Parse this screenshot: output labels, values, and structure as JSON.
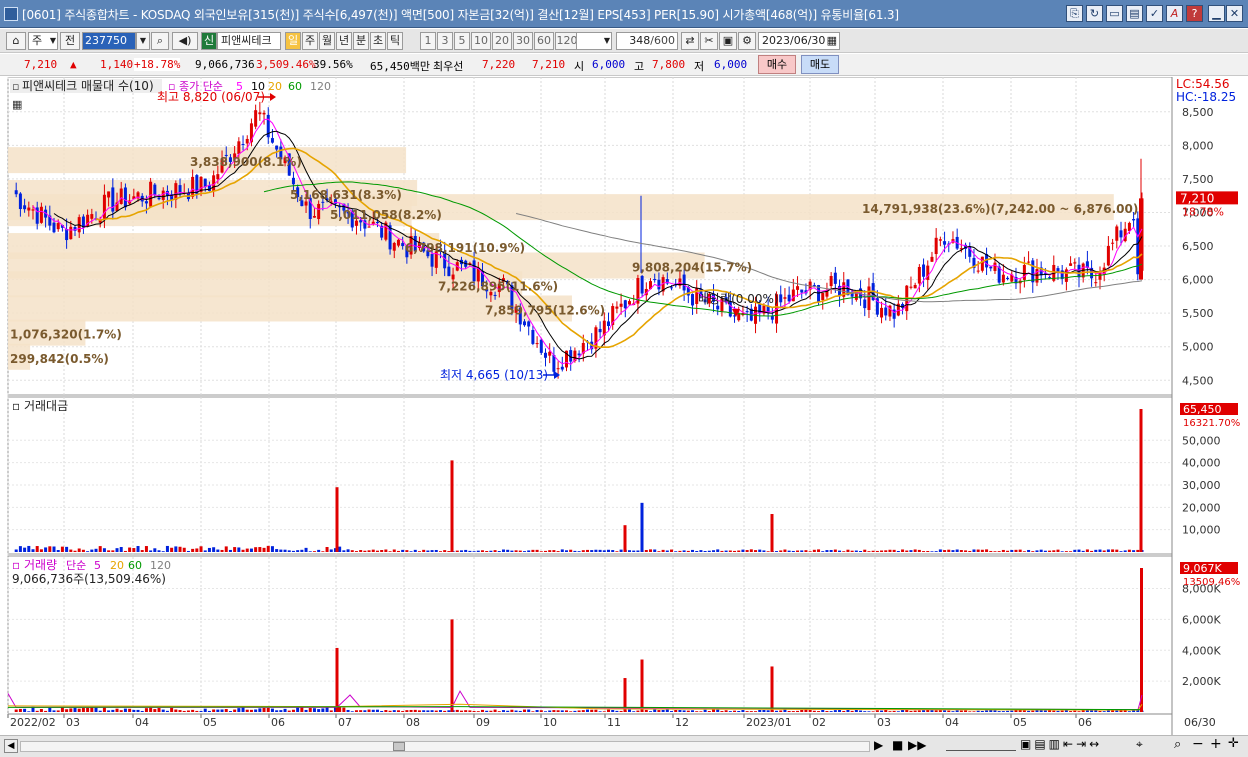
{
  "window": {
    "title": "[0601] 주식종합차트 - KOSDAQ 외국인보유[315(천)] 주식수[6,497(천)] 액면[500] 자본금[32(억)] 결산[12월] EPS[453] PER[15.90] 시가총액[468(억)] 유통비율[61.3]",
    "icons": [
      "link-icon",
      "refresh-icon",
      "window-icon",
      "monitor-icon",
      "settings-icon",
      "font-icon",
      "help-icon",
      "minimize-icon",
      "restore-icon",
      "close-icon"
    ]
  },
  "toolbar": {
    "period_select": "주",
    "prev_label": "전",
    "code": "237750",
    "badge": "신",
    "stock_name": "피앤씨테크",
    "period_tabs": [
      "일",
      "주",
      "월",
      "년",
      "분",
      "초",
      "틱"
    ],
    "active_tab": "일",
    "intervals": [
      "1",
      "3",
      "5",
      "10",
      "20",
      "30",
      "60",
      "120"
    ],
    "count": "348",
    "count_total": "/600",
    "date": "2023/06/30"
  },
  "quote": {
    "price": "7,210",
    "up_mark": "▲",
    "change": "1,140",
    "change_pct": "+18.78%",
    "volume": "9,066,736",
    "vol_ratio": "3,509.46%",
    "turnover": "39.56%",
    "amount": "65,450백만",
    "priority_label": "최우선",
    "ask": "7,220",
    "bid": "7,210",
    "open_label": "시",
    "open": "6,000",
    "high_label": "고",
    "high": "7,800",
    "low_label": "저",
    "low": "6,000",
    "buy_button": "매수",
    "sell_button": "매도"
  },
  "price_panel": {
    "legend_title": "피앤씨테크 매물대 수(10)",
    "ma_label": "종가 단순",
    "ma_periods": [
      "5",
      "10",
      "20",
      "60",
      "120"
    ],
    "ma_colors": [
      "#ff00ff",
      "#000000",
      "#e6a400",
      "#009900",
      "#808080"
    ],
    "lc": "LC:54.56",
    "hc": "HC:-18.25",
    "y_ticks": [
      "8,500",
      "8,000",
      "7,500",
      "7,000",
      "6,500",
      "6,000",
      "5,500",
      "5,000",
      "4,500"
    ],
    "current_price_tag": "7,210",
    "current_pct_tag": "18.78%",
    "high_note": "최고 8,820 (06/07)",
    "low_note": "최저 4,665 (10/13)",
    "dividend_note": "배당락(0.00%)",
    "volume_profile": [
      {
        "label": "3,838,900(8.1%)",
        "price": 7750,
        "frac": 0.36
      },
      {
        "label": "5,168,631(8.3%)",
        "price": 7260,
        "frac": 0.37
      },
      {
        "label": "5,011,058(8.2%)",
        "price": 6960,
        "frac": 0.365
      },
      {
        "label": "14,791,938(23.6%)(7,242.00 ~ 6,876.00)",
        "price": 7050,
        "frac": 1.0
      },
      {
        "label": "6,798,191(10.9%)",
        "price": 6470,
        "frac": 0.39
      },
      {
        "label": "9,808,204(15.7%)",
        "price": 6180,
        "frac": 0.63
      },
      {
        "label": "7,226,895(11.6%)",
        "price": 5900,
        "frac": 0.465
      },
      {
        "label": "7,859,795(12.6%)",
        "price": 5540,
        "frac": 0.51
      },
      {
        "label": "1,076,320(1.7%)",
        "price": 5180,
        "frac": 0.07
      },
      {
        "label": "299,842(0.5%)",
        "price": 4820,
        "frac": 0.02
      }
    ]
  },
  "amount_panel": {
    "title": "거래대금",
    "y_ticks": [
      "50,000",
      "40,000",
      "30,000",
      "20,000",
      "10,000"
    ],
    "value_tag": "65,450",
    "sub_tag": "16321.70%"
  },
  "volume_panel": {
    "title": "거래량",
    "ma_label": "단순",
    "ma_periods": [
      "5",
      "20",
      "60",
      "120"
    ],
    "total": "9,066,736주(13,509.46%)",
    "y_ticks": [
      "8,000K",
      "6,000K",
      "4,000K",
      "2,000K"
    ],
    "value_tag": "9,067K",
    "sub_tag": "13509.46%"
  },
  "x_axis": {
    "labels": [
      "2022/02",
      "03",
      "04",
      "05",
      "06",
      "07",
      "08",
      "09",
      "10",
      "11",
      "12",
      "2023/01",
      "02",
      "03",
      "04",
      "05",
      "06"
    ],
    "right_label": "06/30"
  },
  "chart_data": {
    "type": "candlestick",
    "price_range": [
      4400,
      8750
    ],
    "monthly_close_path": [
      7300,
      6700,
      7150,
      7300,
      7400,
      8500,
      7050,
      6950,
      6500,
      6200,
      5900,
      4750,
      5250,
      6100,
      5700,
      5350,
      5800,
      5900,
      5500,
      6700,
      6100,
      6150,
      6050,
      7210
    ],
    "current_price": 7210,
    "high": {
      "value": 8820,
      "date": "06/07"
    },
    "low": {
      "value": 4665,
      "date": "10/13"
    },
    "amount_spikes_million": [
      {
        "month": "07",
        "value": 29000
      },
      {
        "month": "08",
        "value": 41000
      },
      {
        "month": "11",
        "value": 22000
      },
      {
        "month": "11b",
        "value": 12000
      },
      {
        "month": "2023/01",
        "value": 17000
      },
      {
        "month": "06/30",
        "value": 65450
      }
    ],
    "volume_spikes_k": [
      {
        "month": "07",
        "value": 4150
      },
      {
        "month": "08",
        "value": 6000
      },
      {
        "month": "11",
        "value": 3400
      },
      {
        "month": "2023/01",
        "value": 2950
      },
      {
        "month": "06/30",
        "value": 9067
      }
    ]
  },
  "statusbar": {
    "icons": [
      "play-icon",
      "stop-icon",
      "fast-forward-icon",
      "zoom-in-icon",
      "zoom-out-icon",
      "add-icon",
      "minus-icon",
      "expand-icon"
    ]
  }
}
